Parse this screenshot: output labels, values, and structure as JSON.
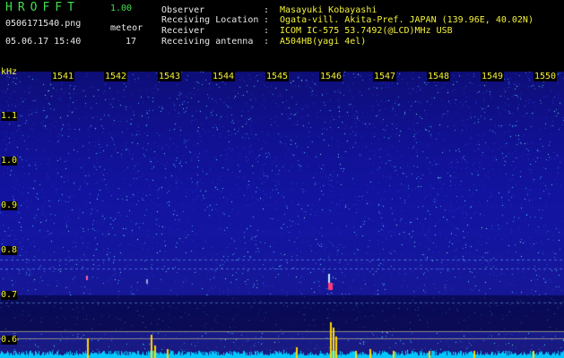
{
  "header": {
    "logo": "HROFFT",
    "version": "1.00",
    "filename": "0506171540.png",
    "timestamp": "05.06.17 15:40",
    "meteor_label": "meteor",
    "meteor_count": "17"
  },
  "info": [
    {
      "label": "Observer",
      "value": "Masayuki Kobayashi"
    },
    {
      "label": "Receiving Location",
      "value": "Ogata-vill. Akita-Pref. JAPAN (139.96E, 40.02N)"
    },
    {
      "label": "Receiver",
      "value": "ICOM IC-575 53.7492(@LCD)MHz USB"
    },
    {
      "label": "Receiving antenna",
      "value": "A504HB(yagi 4el)"
    }
  ],
  "separator": ":",
  "axis": {
    "unit": "kHz",
    "x_ticks": [
      "1541",
      "1542",
      "1543",
      "1544",
      "1545",
      "1546",
      "1547",
      "1548",
      "1549",
      "1550"
    ],
    "y_ticks": [
      "1.1",
      "1.0",
      "0.9",
      "0.8",
      "0.7",
      "0.6"
    ]
  },
  "colors": {
    "background": "#000000",
    "spectrogram_base": "#1a1a8c",
    "trace": "#00c8ff",
    "meteor": "#ffd800",
    "text_label": "#f4f23a",
    "text_header": "#3fe04a"
  }
}
